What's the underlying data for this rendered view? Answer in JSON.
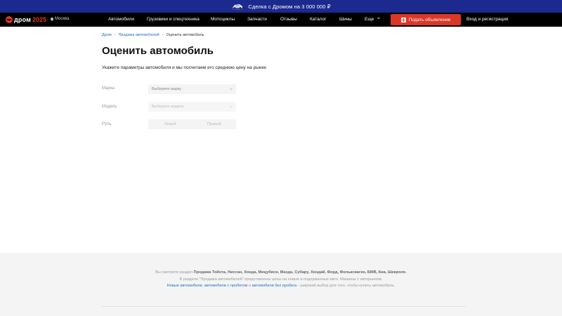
{
  "promo": {
    "text": "Сделка с Дромом на 3 000 000 ₽"
  },
  "header": {
    "logo": "дром",
    "logo_year": "2025",
    "city": "Москва",
    "nav": [
      "Автомобили",
      "Грузовики и спецтехника",
      "Мотоциклы",
      "Запчасти",
      "Отзывы",
      "Каталог",
      "Шины",
      "Еще"
    ],
    "post_button": "Подать объявление",
    "login": "Вход и регистрация"
  },
  "breadcrumbs": [
    "Дром",
    "Продажа автомобилей",
    "Оценить автомобиль"
  ],
  "page": {
    "title": "Оценить автомобиль",
    "subtitle": "Укажите параметры автомобиля и мы посчитаем его среднюю цену на рынке"
  },
  "form": {
    "brand_label": "Марка",
    "brand_placeholder": "Выберите марку",
    "model_label": "Модель",
    "model_placeholder": "Выберите модель",
    "wheel_label": "Руль",
    "wheel_options": [
      "Левый",
      "Правый"
    ]
  },
  "footer": {
    "line1_prefix": "Вы смотрите раздел ",
    "line1_brands": "Продажа Тойота, Ниссан, Хонда, Мицубиси, Мазда, Субару, Хендай, Форд, Фольксваген, БМВ, Киа, Шевроле.",
    "line2": "В разделе \"Продажа автомобилей\" представлены цены на новые и подержанные авто. Машины с авторынков.",
    "link_new": "Новые автомобили",
    "sep1": ", ",
    "link_used": "автомобили с пробегом",
    "sep2": " и ",
    "link_nomileage": "автомобили без пробега",
    "line3_suffix": " - широкий выбор для того, чтобы купить автомобиль."
  },
  "colors": {
    "accent": "#db3727",
    "promo_bg": "#1c2a8f",
    "link": "#1a6fc4"
  }
}
